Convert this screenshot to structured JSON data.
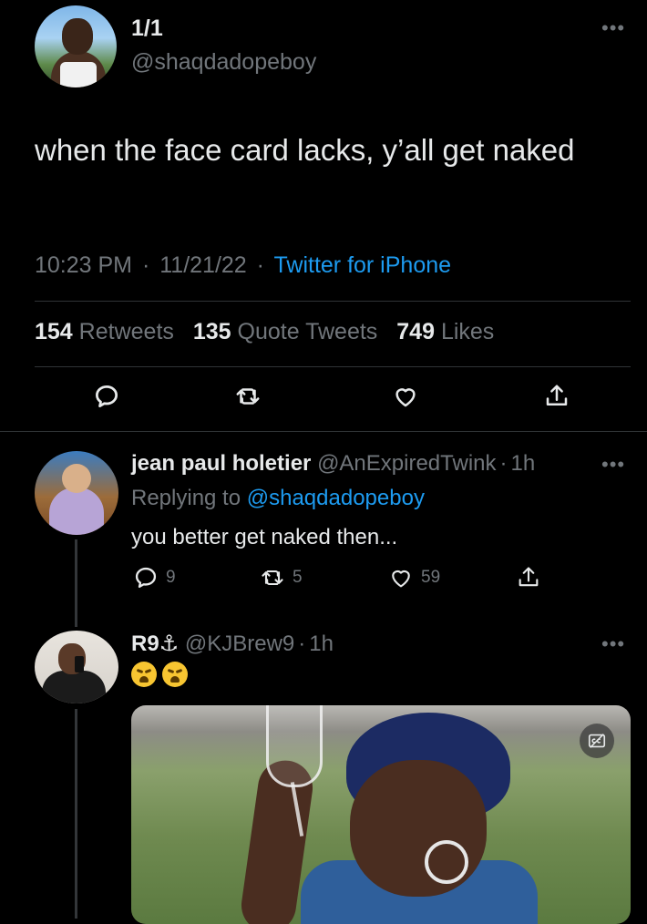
{
  "main_tweet": {
    "display_name": "1/1",
    "handle": "@shaqdadopeboy",
    "text": "when the face card lacks, y’all get naked",
    "time": "10:23 PM",
    "date": "11/21/22",
    "source": "Twitter for iPhone",
    "separator": "·",
    "stats": {
      "retweets_count": "154",
      "retweets_label": "Retweets",
      "quotes_count": "135",
      "quotes_label": "Quote Tweets",
      "likes_count": "749",
      "likes_label": "Likes"
    }
  },
  "replies": [
    {
      "display_name": "jean paul holetier",
      "handle": "@AnExpiredTwink",
      "age": "1h",
      "replying_prefix": "Replying to",
      "replying_to": "@shaqdadopeboy",
      "text": "you better get naked then...",
      "reply_count": "9",
      "retweet_count": "5",
      "like_count": "59"
    },
    {
      "display_name": "R9",
      "name_emoji": "⚓",
      "handle": "@KJBrew9",
      "age": "1h",
      "emoji_count": 2
    }
  ],
  "icons": {
    "reply": "reply-icon",
    "retweet": "retweet-icon",
    "like": "heart-icon",
    "share": "share-icon",
    "more": "more-icon",
    "captions": "closed-captions-icon"
  },
  "colors": {
    "background": "#000000",
    "text": "#e7e9ea",
    "muted": "#71767b",
    "link": "#1d9bf0",
    "divider": "#2f3336"
  }
}
